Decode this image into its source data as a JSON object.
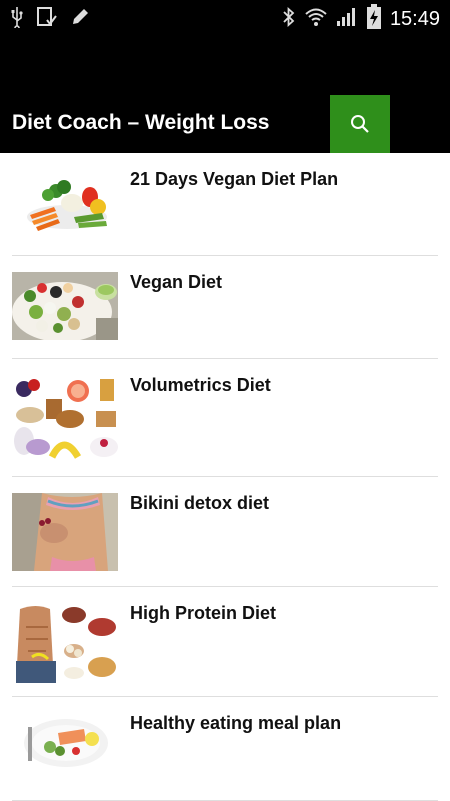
{
  "status_bar": {
    "time": "15:49",
    "left_icons": [
      "usb-icon",
      "screenshot-icon",
      "pencil-icon"
    ],
    "right_icons": [
      "bluetooth-icon",
      "wifi-icon",
      "signal-icon",
      "battery-charging-icon"
    ]
  },
  "app_bar": {
    "title": "Diet Coach – Weight Loss",
    "search_icon": "search-icon",
    "accent_color": "#2f8f1b"
  },
  "articles": [
    {
      "title": "21 Days Vegan Diet Plan",
      "image": "vegetables-image"
    },
    {
      "title": "Vegan Diet",
      "image": "salad-platter-image"
    },
    {
      "title": "Volumetrics Diet",
      "image": "fruit-breakfast-image"
    },
    {
      "title": "Bikini detox diet",
      "image": "bikini-body-image"
    },
    {
      "title": "High Protein Diet",
      "image": "protein-foods-image"
    },
    {
      "title": "Healthy eating meal plan",
      "image": "salmon-salad-image"
    }
  ]
}
